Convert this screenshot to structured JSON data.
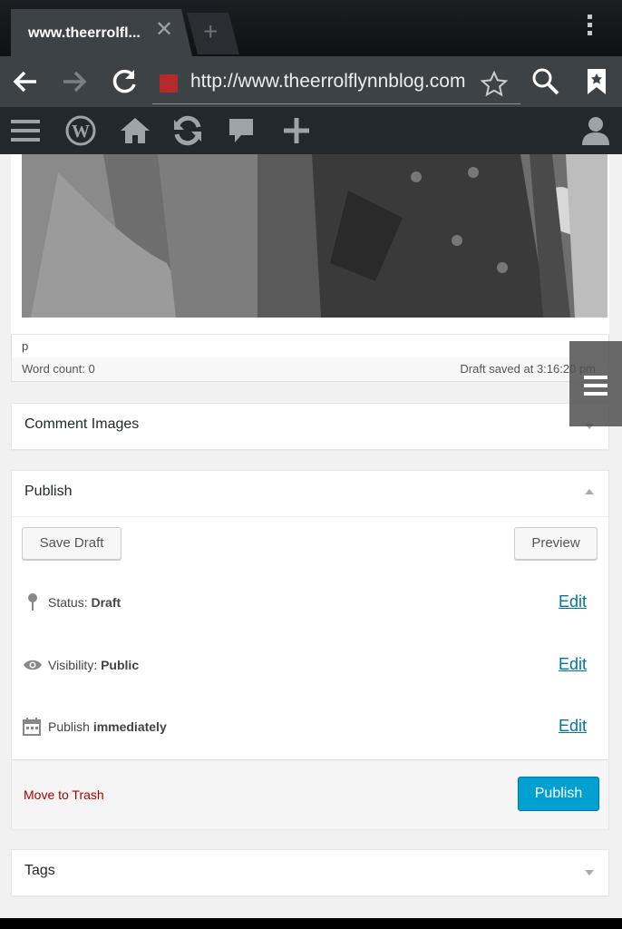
{
  "browser": {
    "tab_title": "www.theerrolfl...",
    "url": "http://www.theerrolflynnblog.com"
  },
  "editor": {
    "path_label": "p",
    "word_count": "Word count: 0",
    "draft_saved": "Draft saved at 3:16:20 pm"
  },
  "comment_images": {
    "title": "Comment Images"
  },
  "publish": {
    "title": "Publish",
    "save_draft": "Save Draft",
    "preview": "Preview",
    "status_label": "Status:",
    "status_value": "Draft",
    "visibility_label": "Visibility:",
    "visibility_value": "Public",
    "schedule_label": "Publish",
    "schedule_value": "immediately",
    "edit_label": "Edit",
    "trash": "Move to Trash",
    "publish_button": "Publish"
  },
  "tags": {
    "title": "Tags"
  },
  "colors": {
    "admin_bar": "#23282d",
    "link": "#0073aa",
    "primary_button": "#00a0d2",
    "trash": "#a00"
  }
}
